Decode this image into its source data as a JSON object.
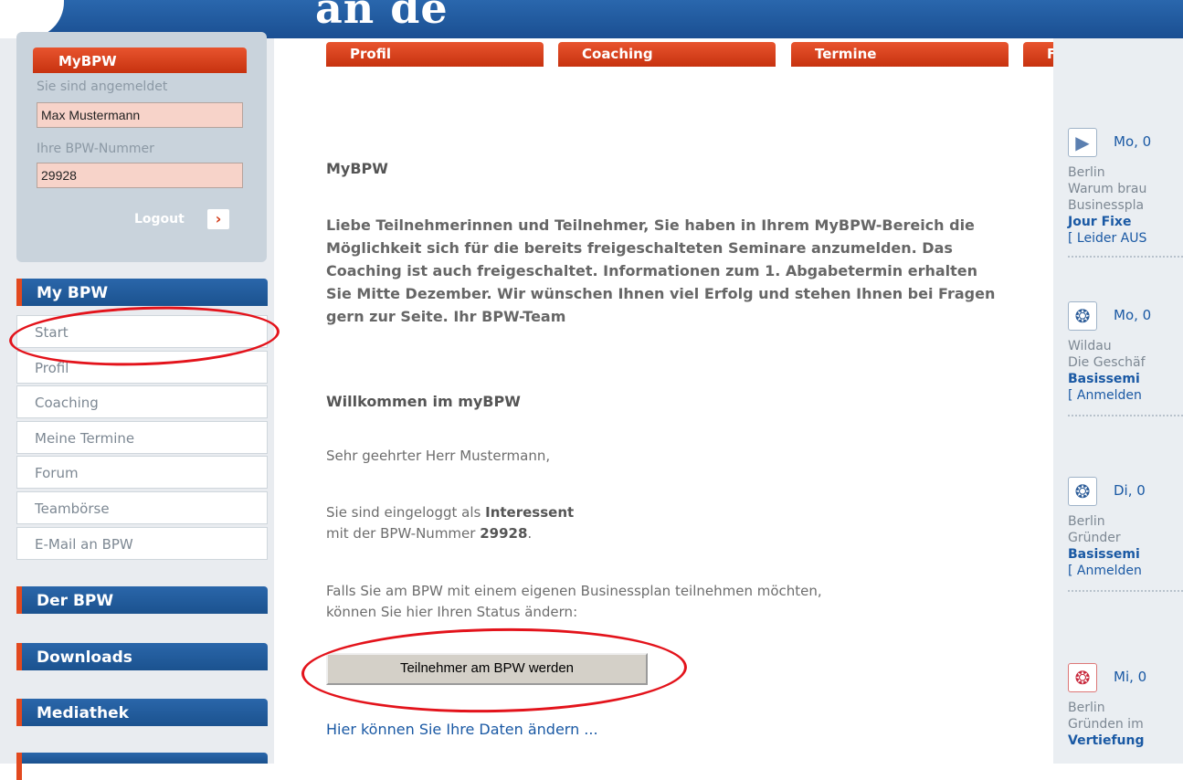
{
  "header": {
    "logo_text": "an de"
  },
  "topnav": [
    {
      "label": "Profil"
    },
    {
      "label": "Coaching"
    },
    {
      "label": "Termine"
    },
    {
      "label": "Forum"
    }
  ],
  "account": {
    "title": "MyBPW",
    "logged_in_label": "Sie sind angemeldet",
    "user_name": "Max Mustermann",
    "number_label": "Ihre BPW-Nummer",
    "number_value": "29928",
    "logout_label": "Logout",
    "logout_arrow": "›"
  },
  "sidebar": {
    "mybpw_header": "My BPW",
    "items": [
      {
        "label": "Start"
      },
      {
        "label": "Profil"
      },
      {
        "label": "Coaching"
      },
      {
        "label": "Meine Termine"
      },
      {
        "label": "Forum"
      },
      {
        "label": "Teambörse"
      },
      {
        "label": "E-Mail an BPW"
      }
    ],
    "sections": [
      {
        "label": "Der BPW"
      },
      {
        "label": "Downloads"
      },
      {
        "label": "Mediathek"
      }
    ]
  },
  "main": {
    "heading": "MyBPW",
    "intro": "Liebe Teilnehmerinnen und Teilnehmer, Sie haben in Ihrem MyBPW-Bereich die Möglichkeit sich für die bereits freigeschalteten Seminare anzumelden. Das Coaching ist auch freigeschaltet. Informationen zum 1. Abgabetermin erhalten Sie Mitte Dezember. Wir wünschen Ihnen viel Erfolg und stehen Ihnen bei Fragen gern zur Seite. Ihr BPW-Team",
    "welcome": "Willkommen im myBPW",
    "greeting": "Sehr geehrter Herr Mustermann,",
    "status_prefix": "Sie sind eingeloggt als ",
    "status_value": "Interessent",
    "number_prefix": "mit der BPW-Nummer ",
    "number_value": "29928",
    "number_suffix": ".",
    "change_line1": "Falls Sie am BPW mit einem eigenen Businessplan teilnehmen möchten,",
    "change_line2": "können Sie hier Ihren Status ändern:",
    "button_label": "Teilnehmer am BPW werden",
    "edit_link": "Hier können Sie Ihre Daten ändern ..."
  },
  "events": [
    {
      "icon": "play-icon",
      "date": "Mo, 0",
      "location": "Berlin",
      "desc": "Warum brau",
      "desc2": "Businesspla",
      "title": "Jour Fixe",
      "action": "[ Leider AUS"
    },
    {
      "icon": "seminar-icon",
      "date": "Mo, 0",
      "location": "Wildau",
      "desc": "Die Geschäf",
      "title": "Basissemi",
      "action": "[ Anmelden"
    },
    {
      "icon": "seminar-icon",
      "date": "Di, 0",
      "location": "Berlin",
      "desc": "Gründer",
      "title": "Basissemi",
      "action": "[ Anmelden"
    },
    {
      "icon": "seminar-red-icon",
      "date": "Mi, 0",
      "location": "Berlin",
      "desc": "Gründen im",
      "title": "Vertiefung"
    }
  ],
  "colors": {
    "brand_blue": "#1e5aa0",
    "accent_red": "#d63a17",
    "annotation_red": "#e3131b"
  }
}
